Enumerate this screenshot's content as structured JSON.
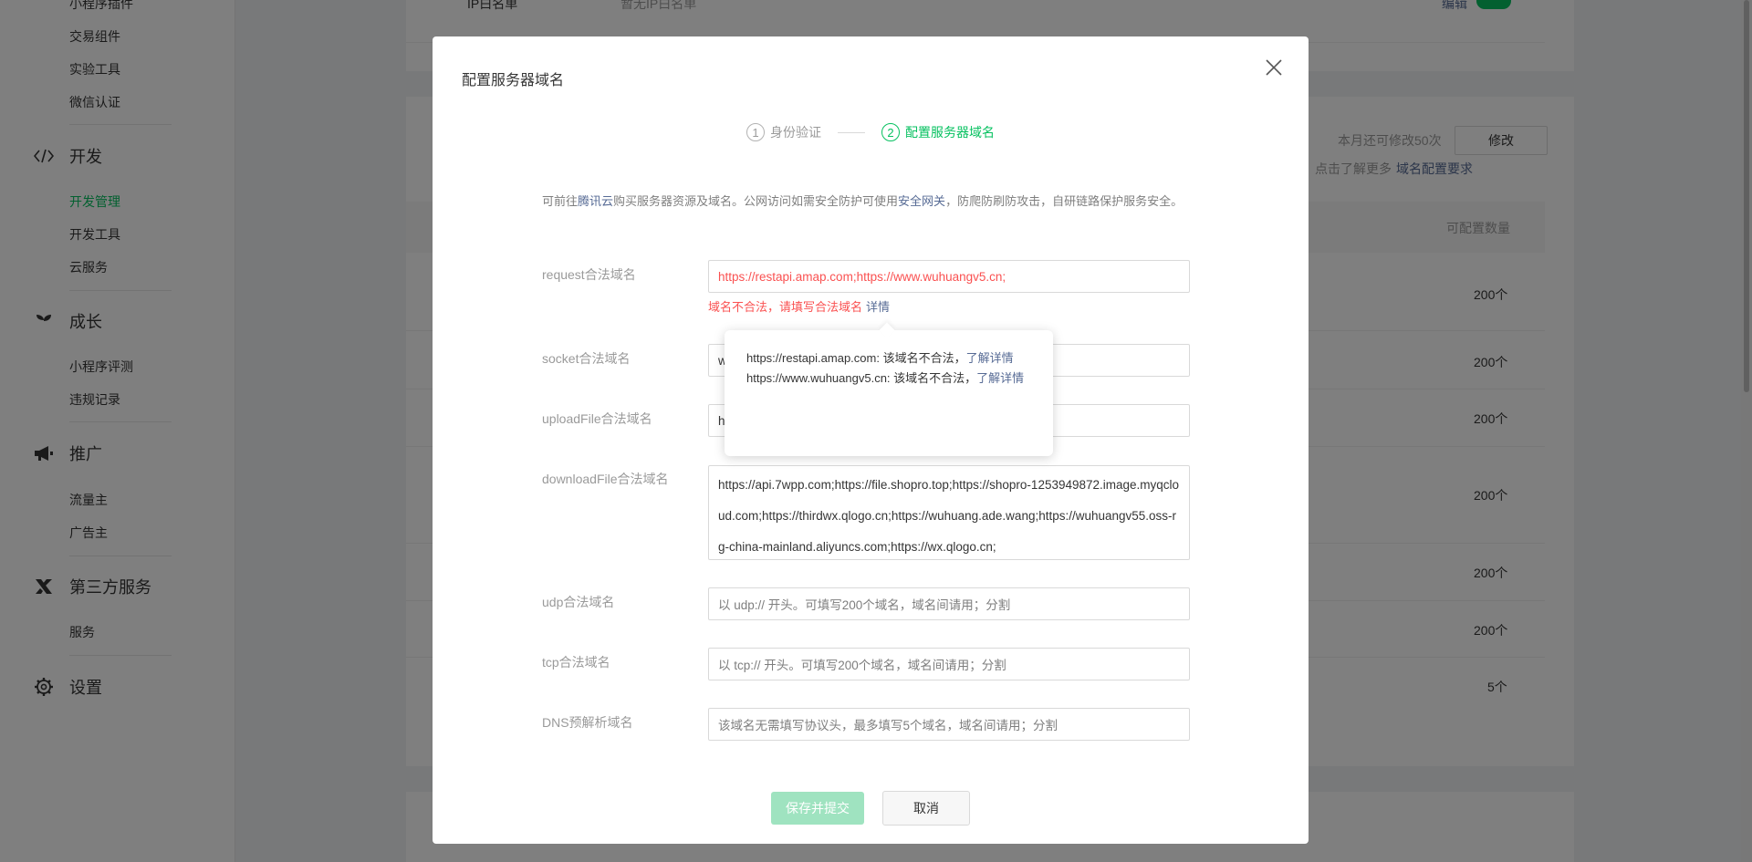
{
  "sidebar": {
    "sub_top": [
      "小程序插件",
      "交易组件",
      "实验工具",
      "微信认证"
    ],
    "groups": {
      "dev": {
        "label": "开发",
        "items": [
          "开发管理",
          "开发工具",
          "云服务"
        ]
      },
      "growth": {
        "label": "成长",
        "items": [
          "小程序评测",
          "违规记录"
        ]
      },
      "promo": {
        "label": "推广",
        "items": [
          "流量主",
          "广告主"
        ]
      },
      "third": {
        "label": "第三方服务",
        "items": [
          "服务"
        ]
      },
      "settings": {
        "label": "设置"
      }
    }
  },
  "background": {
    "ip_label": "IP白名单",
    "ip_value": "暂无IP白名单",
    "edit_link": "编辑",
    "quota_text": "本月还可修改50次",
    "modify_button": "修改",
    "learn_more_text": "点击了解更多",
    "domain_config_link": "域名配置要求",
    "column_header": "可配置数量",
    "row_counts": [
      "200个",
      "200个",
      "200个",
      "200个",
      "200个",
      "200个",
      "5个"
    ]
  },
  "modal": {
    "title": "配置服务器域名",
    "steps": [
      {
        "num": "1",
        "label": "身份验证"
      },
      {
        "num": "2",
        "label": "配置服务器域名"
      }
    ],
    "intro": {
      "part1": "可前往",
      "link1": "腾讯云",
      "part2": "购买服务器资源及域名。公网访问如需安全防护可使用",
      "link2": "安全网关",
      "part3": "，防爬防刷防攻击，自研链路保护服务安全。"
    },
    "fields": {
      "request": {
        "label": "request合法域名",
        "value": "https://restapi.amap.com;https://www.wuhuangv5.cn;"
      },
      "socket": {
        "label": "socket合法域名",
        "value": "w"
      },
      "upload": {
        "label": "uploadFile合法域名",
        "value": "h"
      },
      "download": {
        "label": "downloadFile合法域名",
        "value": "https://api.7wpp.com;https://file.shopro.top;https://shopro-1253949872.image.myqcloud.com;https://thirdwx.qlogo.cn;https://wuhuang.ade.wang;https://wuhuangv55.oss-rg-china-mainland.aliyuncs.com;https://wx.qlogo.cn;"
      },
      "udp": {
        "label": "udp合法域名",
        "placeholder": "以 udp:// 开头。可填写200个域名，域名间请用；分割"
      },
      "tcp": {
        "label": "tcp合法域名",
        "placeholder": "以 tcp:// 开头。可填写200个域名，域名间请用；分割"
      },
      "dns": {
        "label": "DNS预解析域名",
        "placeholder": "该域名无需填写协议头，最多填写5个域名，域名间请用；分割"
      }
    },
    "error": {
      "text": "域名不合法，请填写合法域名",
      "detail_link": "详情"
    },
    "popover": {
      "line1": "https://restapi.amap.com: 该域名不合法，",
      "line1_link": "了解详情",
      "line2": "https://www.wuhuangv5.cn: 该域名不合法，",
      "line2_link": "了解详情"
    },
    "buttons": {
      "submit": "保存并提交",
      "cancel": "取消"
    }
  },
  "colors": {
    "brand_green": "#07c160",
    "error_red": "#fa5151",
    "link_blue": "#576b95"
  }
}
